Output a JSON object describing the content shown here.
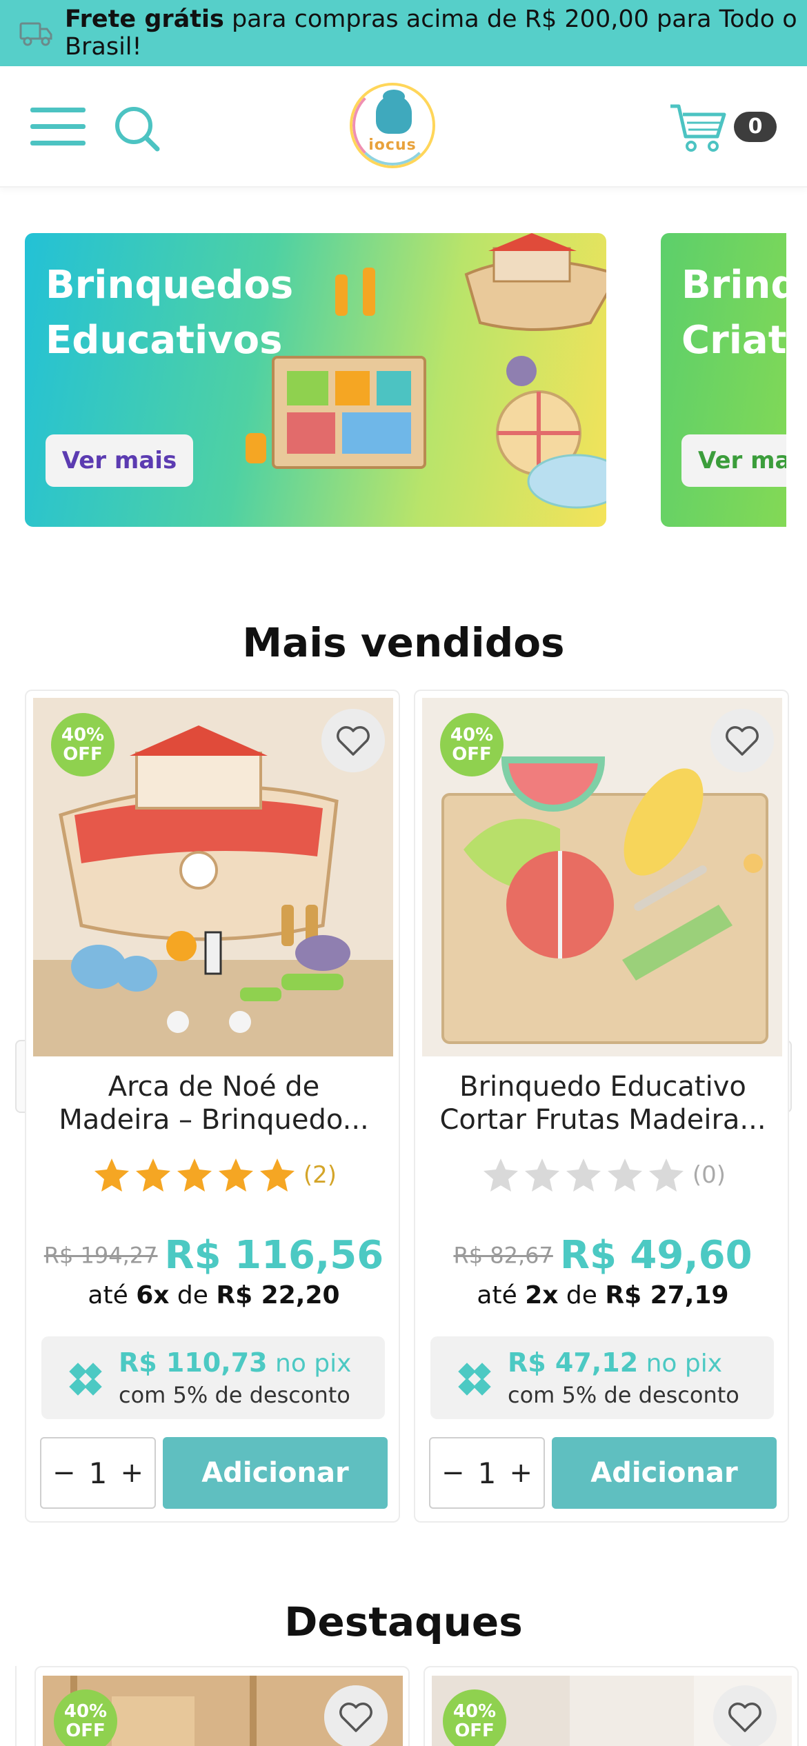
{
  "announcement": {
    "bold": "Frete grátis",
    "text": " para compras acima de R$ 200,00 para Todo o Brasil!"
  },
  "header": {
    "logo_text": "iocus",
    "cart_count": "0"
  },
  "banners": [
    {
      "title": "Brinquedos\nEducativos",
      "button": "Ver mais"
    },
    {
      "title": "Brinq\nCriati",
      "button": "Ver ma"
    }
  ],
  "best_sellers": {
    "title": "Mais vendidos",
    "products": [
      {
        "badge_pct": "40%",
        "badge_off": "OFF",
        "name_line1": "Arca de Noé de",
        "name_line2": "Madeira – Brinquedo...",
        "rating": 5,
        "review_count": "(2)",
        "old_price": "R$ 194,27",
        "price": "R$ 116,56",
        "inst_prefix": "até ",
        "inst_times": "6x",
        "inst_mid": " de ",
        "inst_value": "R$ 22,20",
        "pix_amount": "R$ 110,73",
        "pix_label": " no pix",
        "pix_desc": "com 5% de desconto",
        "qty": "1",
        "add_label": "Adicionar"
      },
      {
        "badge_pct": "40%",
        "badge_off": "OFF",
        "name_line1": "Brinquedo Educativo",
        "name_line2": "Cortar Frutas Madeira...",
        "rating": 0,
        "review_count": "(0)",
        "old_price": "R$ 82,67",
        "price": "R$ 49,60",
        "inst_prefix": "até ",
        "inst_times": "2x",
        "inst_mid": " de ",
        "inst_value": "R$ 27,19",
        "pix_amount": "R$ 47,12",
        "pix_label": " no pix",
        "pix_desc": "com 5% de desconto",
        "qty": "1",
        "add_label": "Adicionar"
      }
    ]
  },
  "highlights": {
    "title": "Destaques",
    "products": [
      {
        "badge_pct": "40%",
        "badge_off": "OFF"
      },
      {
        "badge_pct": "40%",
        "badge_off": "OFF"
      }
    ]
  },
  "nav": {
    "prev": "〈",
    "next": "〉"
  },
  "colors": {
    "accent": "#4cc9c3",
    "topbar": "#56cfc9",
    "badge": "#8fd14f",
    "star_filled": "#f5a623",
    "star_empty": "#d9d9d9",
    "button": "#5fbfc0"
  },
  "icons": {
    "menu": "hamburger-menu-icon",
    "search": "search-icon",
    "cart": "shopping-cart-icon",
    "favorite": "heart-icon",
    "pix": "pix-icon",
    "truck": "truck-icon"
  }
}
